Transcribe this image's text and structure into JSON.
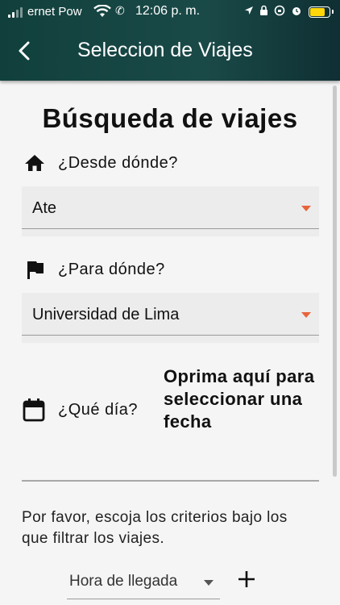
{
  "status_bar": {
    "carrier": "ernet Pow",
    "time": "12:06 p. m.",
    "icons": [
      "signal-icon",
      "wifi-icon",
      "call-icon",
      "location-icon",
      "lock-icon",
      "rotation-lock-icon",
      "alarm-icon",
      "battery-icon"
    ],
    "battery_color": "#ffd60a"
  },
  "app_bar": {
    "title": "Seleccion de Viajes",
    "back_icon": "chevron-left-icon"
  },
  "page": {
    "heading": "Búsqueda de viajes",
    "origin": {
      "label": "¿Desde dónde?",
      "icon": "home-icon",
      "selected": "Ate"
    },
    "destination": {
      "label": "¿Para dónde?",
      "icon": "flag-icon",
      "selected": "Universidad de Lima"
    },
    "date": {
      "label": "¿Qué día?",
      "icon": "calendar-icon",
      "action": "Oprima aquí para seleccionar una fecha"
    },
    "filter_note": "Por favor, escoja los criterios bajo los que filtrar los viajes.",
    "filter_select": "Hora de llegada",
    "add_icon": "plus-icon"
  },
  "colors": {
    "app_bar": "#15403d",
    "dropdown_arrow": "#e8643a",
    "background": "#f5f5f5"
  }
}
